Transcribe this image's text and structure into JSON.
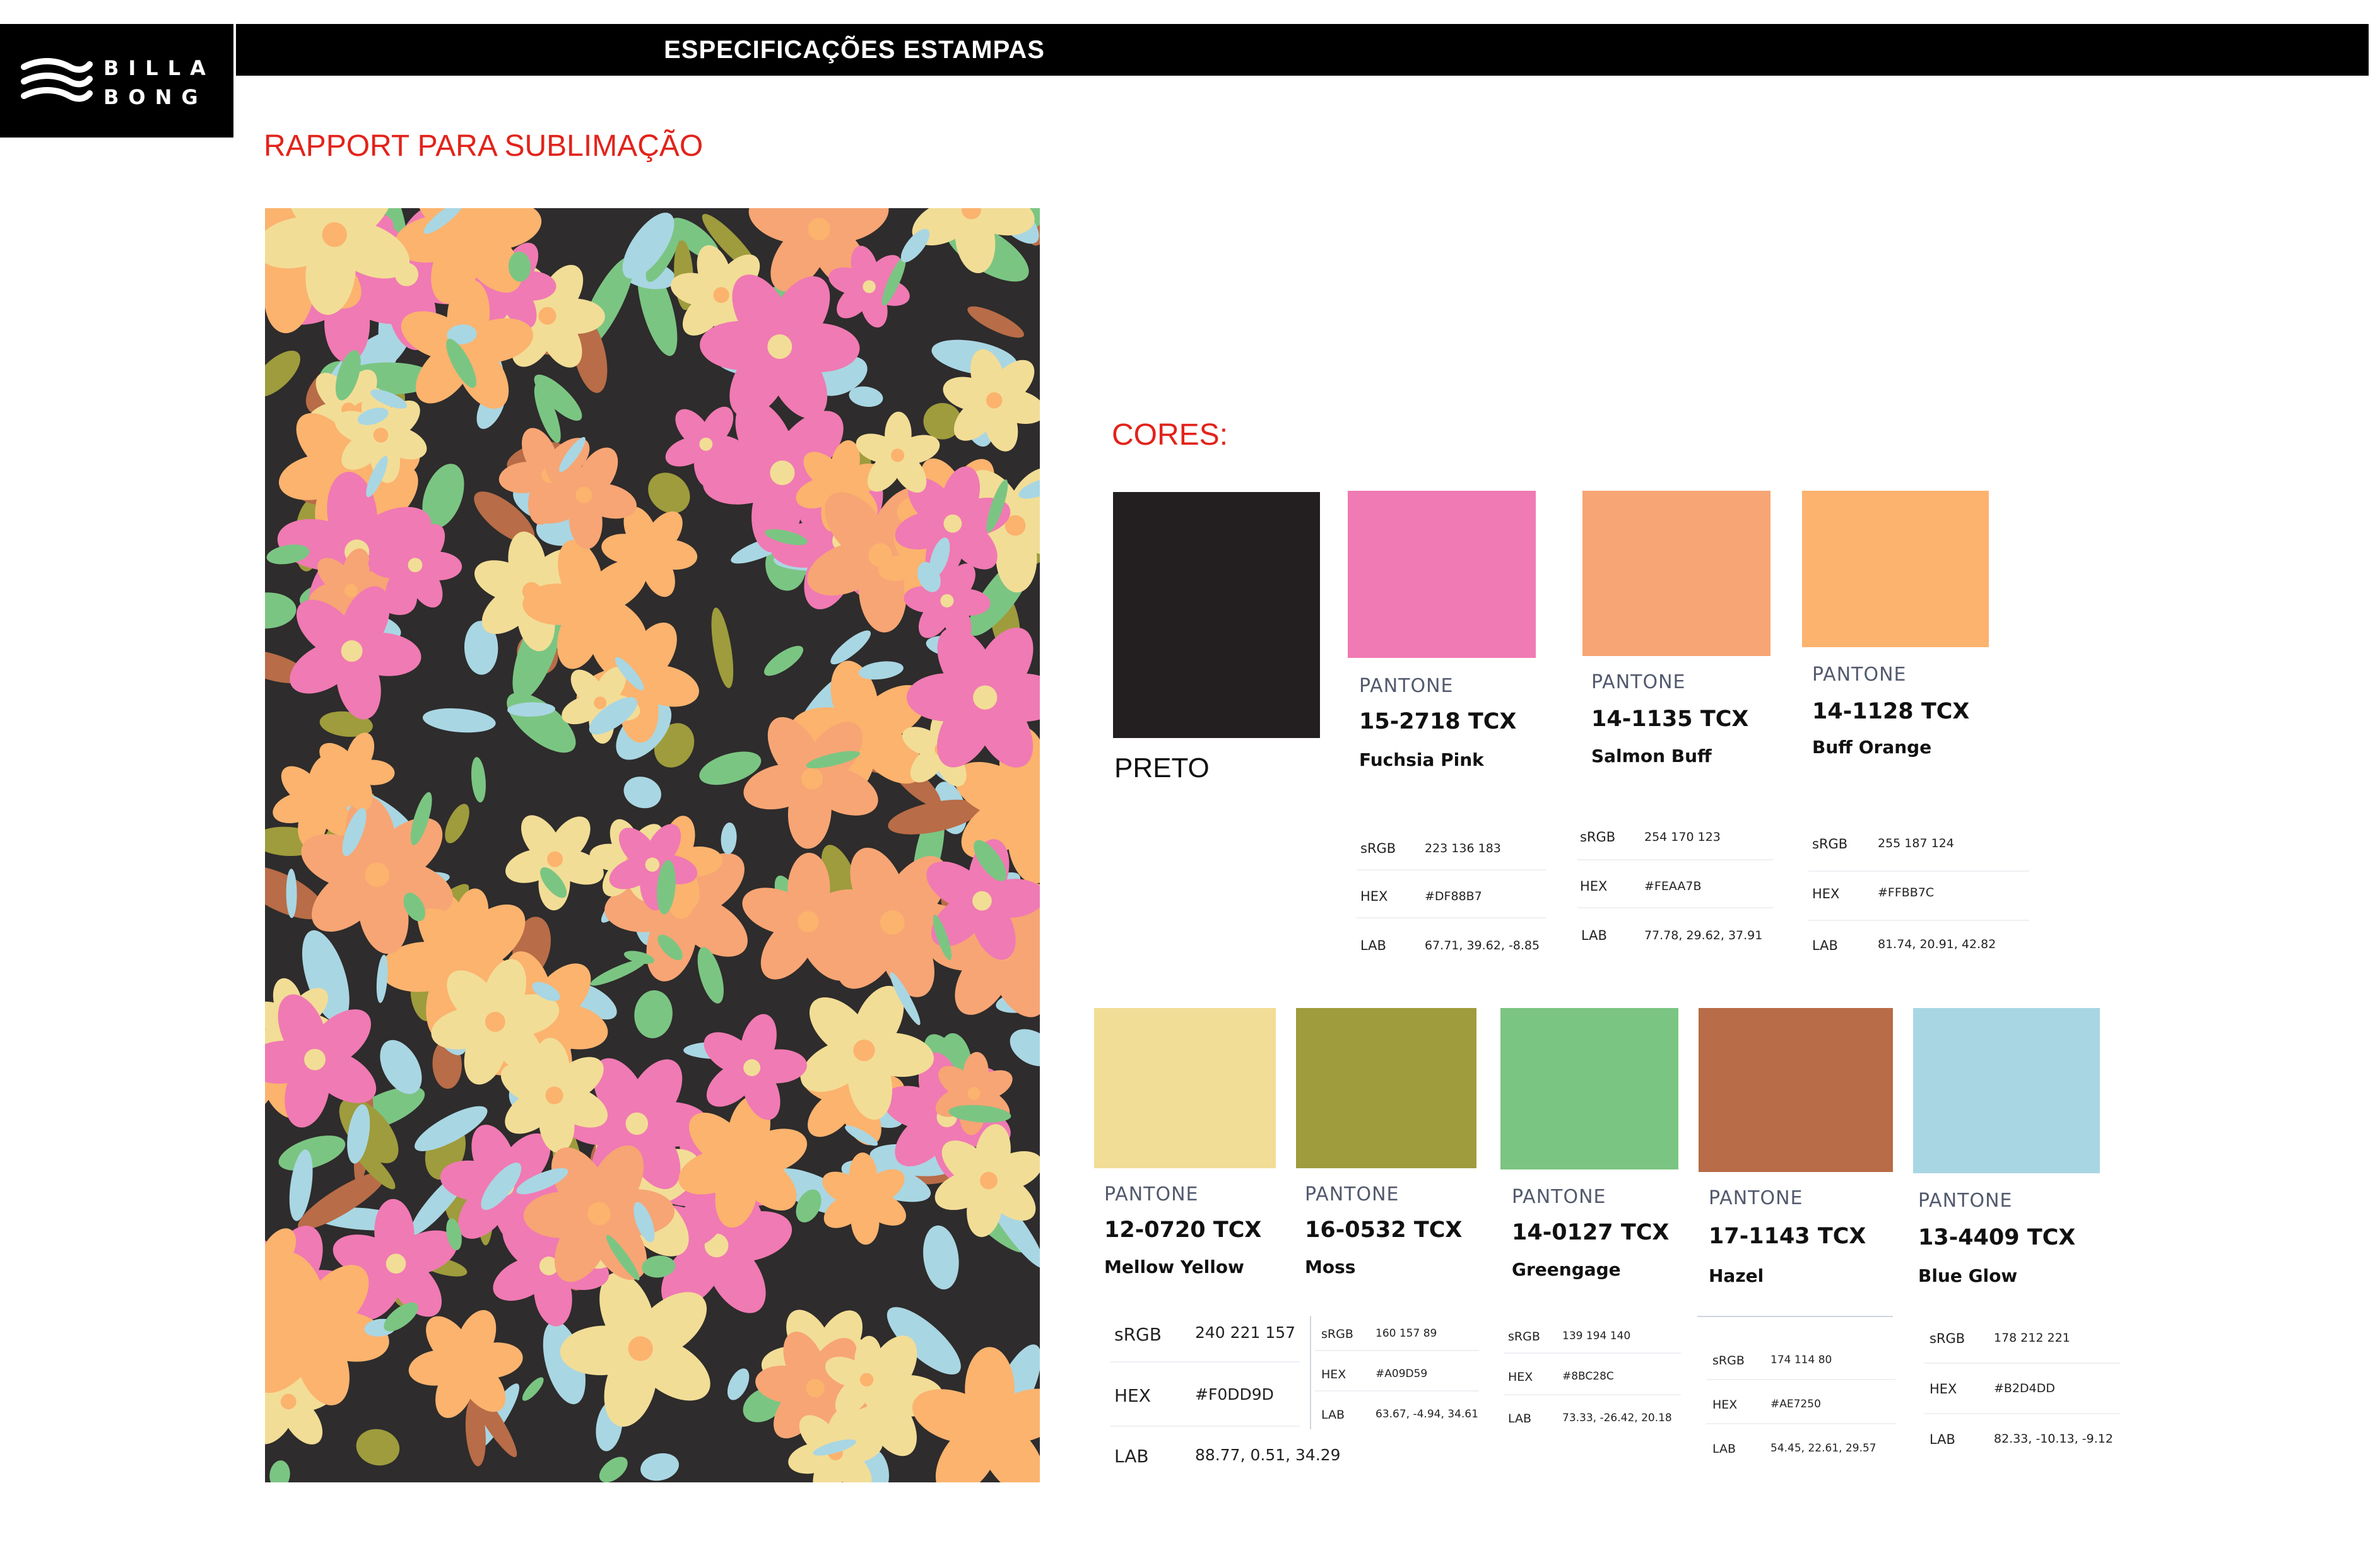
{
  "brand": {
    "word_1": "BILLA",
    "word_2": "BONG"
  },
  "header": {
    "title": "ESPECIFICAÇÕES ESTAMPAS"
  },
  "section_rapport": "RAPPORT PARA SUBLIMAÇÃO",
  "section_cores": "CORES:",
  "black_swatch": {
    "label": "PRETO",
    "color": "#231f20"
  },
  "top_colors": [
    {
      "pantone_label": "PANTONE",
      "code": "15-2718 TCX",
      "name": "Fuchsia Pink",
      "color": "#f07ab3",
      "srgb_label": "sRGB",
      "srgb": "223 136 183",
      "hex_label": "HEX",
      "hex": "#DF88B7",
      "lab_label": "LAB",
      "lab": "67.71, 39.62, -8.85"
    },
    {
      "pantone_label": "PANTONE",
      "code": "14-1135 TCX",
      "name": "Salmon Buff",
      "color": "#f7a574",
      "srgb_label": "sRGB",
      "srgb": "254 170 123",
      "hex_label": "HEX",
      "hex": "#FEAA7B",
      "lab_label": "LAB",
      "lab": "77.78, 29.62, 37.91"
    },
    {
      "pantone_label": "PANTONE",
      "code": "14-1128 TCX",
      "name": "Buff Orange",
      "color": "#fbb36e",
      "srgb_label": "sRGB",
      "srgb": "255 187 124",
      "hex_label": "HEX",
      "hex": "#FFBB7C",
      "lab_label": "LAB",
      "lab": "81.74, 20.91, 42.82"
    }
  ],
  "bottom_colors": [
    {
      "pantone_label": "PANTONE",
      "code": "12-0720 TCX",
      "name": "Mellow Yellow",
      "color": "#f2dd96",
      "srgb_label": "sRGB",
      "srgb": "240 221 157",
      "hex_label": "HEX",
      "hex": "#F0DD9D",
      "lab_label": "LAB",
      "lab": "88.77, 0.51, 34.29"
    },
    {
      "pantone_label": "PANTONE",
      "code": "16-0532 TCX",
      "name": "Moss",
      "color": "#9e9c3c",
      "srgb_label": "sRGB",
      "srgb": "160 157 89",
      "hex_label": "HEX",
      "hex": "#A09D59",
      "lab_label": "LAB",
      "lab": "63.67, -4.94, 34.61"
    },
    {
      "pantone_label": "PANTONE",
      "code": "14-0127 TCX",
      "name": "Greengage",
      "color": "#7bc583",
      "srgb_label": "sRGB",
      "srgb": "139 194 140",
      "hex_label": "HEX",
      "hex": "#8BC28C",
      "lab_label": "LAB",
      "lab": "73.33, -26.42, 20.18"
    },
    {
      "pantone_label": "PANTONE",
      "code": "17-1143 TCX",
      "name": "Hazel",
      "color": "#b86c47",
      "srgb_label": "sRGB",
      "srgb": "174 114 80",
      "hex_label": "HEX",
      "hex": "#AE7250",
      "lab_label": "LAB",
      "lab": "54.45, 22.61, 29.57"
    },
    {
      "pantone_label": "PANTONE",
      "code": "13-4409 TCX",
      "name": "Blue Glow",
      "color": "#a9d6e3",
      "srgb_label": "sRGB",
      "srgb": "178 212 221",
      "hex_label": "HEX",
      "hex": "#B2D4DD",
      "lab_label": "LAB",
      "lab": "82.33, -10.13, -9.12"
    }
  ],
  "pattern": {
    "background": "#2e2c2c"
  }
}
